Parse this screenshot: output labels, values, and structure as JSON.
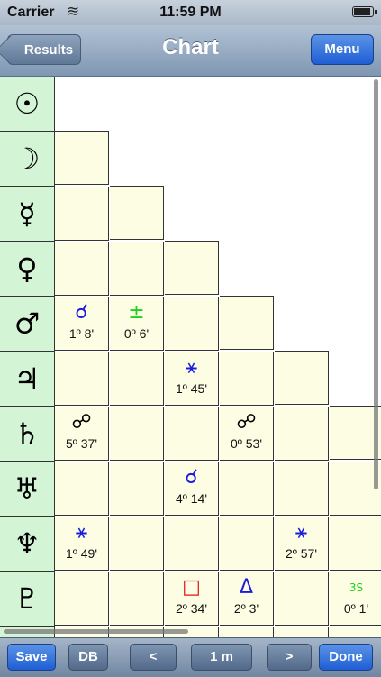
{
  "status_bar": {
    "carrier": "Carrier",
    "time": "11:59 PM",
    "wifi_icon": "wifi-icon",
    "battery_icon": "battery-icon"
  },
  "navbar": {
    "title": "Chart",
    "back_label": "Results",
    "menu_label": "Menu"
  },
  "planets": [
    "☉",
    "☽",
    "☿",
    "♀",
    "♂",
    "♃",
    "♄",
    "♅",
    "♆",
    "♇",
    "♁"
  ],
  "aspects": {
    "r4c0": {
      "symbol": "☌",
      "degree": "1º 8'",
      "color": "#1a1ae0"
    },
    "r4c1": {
      "symbol": "±",
      "degree": "0º 6'",
      "color": "#1cd21c"
    },
    "r5c2": {
      "symbol": "⚹",
      "degree": "1º 45'",
      "color": "#1a1ae0"
    },
    "r6c0": {
      "symbol": "☍",
      "degree": "5º 37'",
      "color": "#000000"
    },
    "r6c3": {
      "symbol": "☍",
      "degree": "0º 53'",
      "color": "#000000"
    },
    "r7c2": {
      "symbol": "☌",
      "degree": "4º 14'",
      "color": "#1a1ae0"
    },
    "r8c0": {
      "symbol": "⚹",
      "degree": "1º 49'",
      "color": "#1a1ae0"
    },
    "r8c4": {
      "symbol": "⚹",
      "degree": "2º 57'",
      "color": "#1a1ae0"
    },
    "r9c2": {
      "symbol": "□",
      "degree": "2º 34'",
      "color": "#e21414"
    },
    "r9c3": {
      "symbol": "Δ",
      "degree": "2º 3'",
      "color": "#1a1ae0"
    },
    "r9c5": {
      "symbol": "3S",
      "degree": "0º 1'",
      "color": "#1cd21c"
    }
  },
  "toolbar": {
    "save_label": "Save",
    "db_label": "DB",
    "prev_label": "<",
    "step_label": "1 m",
    "next_label": ">",
    "done_label": "Done"
  }
}
